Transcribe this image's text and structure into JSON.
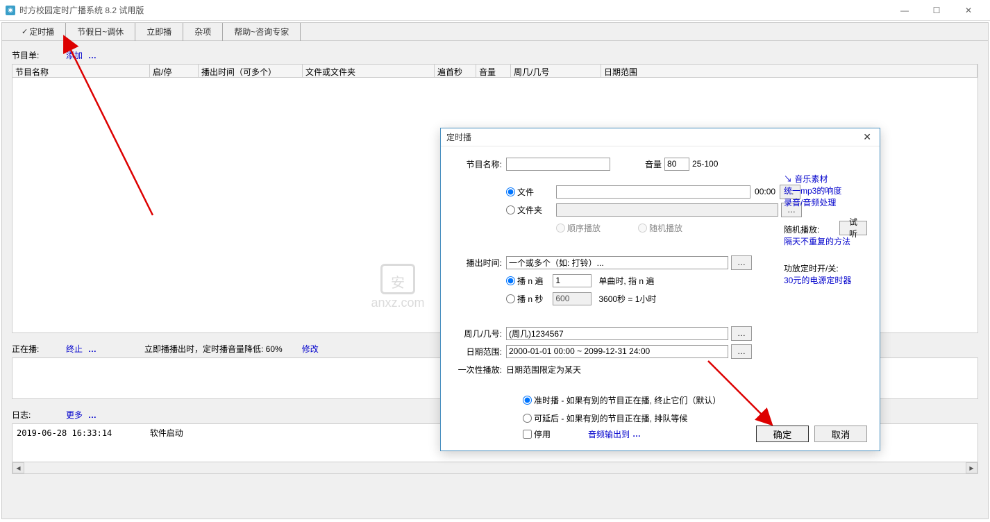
{
  "window": {
    "title": "时方校园定时广播系统 8.2 试用版"
  },
  "tabs": [
    "定时播",
    "节假日~调休",
    "立即播",
    "杂项",
    "帮助~咨询专家"
  ],
  "main": {
    "program_list_label": "节目单:",
    "add_label": "添加",
    "columns": {
      "name": "节目名称",
      "on_off": "启/停",
      "play_time": "播出时间（可多个）",
      "file": "文件或文件夹",
      "skip_sec": "遍首秒",
      "volume": "音量",
      "weekday": "周几/几号",
      "date_range": "日期范围"
    },
    "now_playing_label": "正在播:",
    "stop_label": "终止",
    "instant_note": "立即播播出时，定时播音量降低: 60%",
    "modify_label": "修改",
    "log_label": "日志:",
    "more_label": "更多",
    "log_entry_time": "2019-06-28 16:33:14",
    "log_entry_text": "软件启动"
  },
  "dialog": {
    "title": "定时播",
    "fields": {
      "name_label": "节目名称:",
      "volume_label": "音量",
      "volume_value": "80",
      "volume_range": "25-100",
      "file_radio": "文件",
      "folder_radio": "文件夹",
      "file_time": "00:00",
      "seq_play": "顺序播放",
      "rand_play": "随机播放",
      "try_listen": "试听",
      "play_time_label": "播出时间:",
      "play_time_placeholder": "一个或多个（如: 打铃）...",
      "play_n_times": "播 n 遍",
      "play_n_times_val": "1",
      "play_n_times_note": "单曲时, 指 n 遍",
      "play_n_sec": "播 n 秒",
      "play_n_sec_val": "600",
      "play_n_sec_note": "3600秒 = 1小时",
      "weekday_label": "周几/几号:",
      "weekday_value": "(周几)1234567",
      "date_range_label": "日期范围:",
      "date_range_value": "2000-01-01 00:00 ~ 2099-12-31 24:00",
      "once_label": "一次性播放:",
      "once_note": "日期范围限定为某天",
      "timely_radio": "准时播 - 如果有别的节目正在播, 终止它们（默认）",
      "delay_radio": "可延后 - 如果有别的节目正在播, 排队等候",
      "disable_check": "停用",
      "audio_out": "音频输出到",
      "ok": "确定",
      "cancel": "取消"
    },
    "side": {
      "music_material": "↘ 音乐素材",
      "unify_mp3": "统一mp3的响度",
      "record": "录音/音频处理",
      "rand_label": "随机播放:",
      "rand_link": "隔天不重复的方法",
      "amp_label": "功放定时开/关:",
      "amp_link": "30元的电源定时器"
    }
  },
  "watermark": "anxz.com"
}
